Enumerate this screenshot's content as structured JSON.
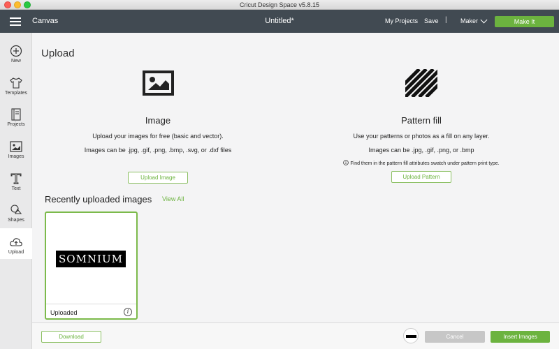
{
  "window": {
    "title": "Cricut Design Space  v5.8.15"
  },
  "header": {
    "canvas_label": "Canvas",
    "document_title": "Untitled*",
    "my_projects": "My Projects",
    "save": "Save",
    "separator": "|",
    "machine": "Maker",
    "make_it": "Make It"
  },
  "sidebar": {
    "items": [
      {
        "label": "New",
        "icon": "plus-circle-icon"
      },
      {
        "label": "Templates",
        "icon": "shirt-icon"
      },
      {
        "label": "Projects",
        "icon": "notebook-icon"
      },
      {
        "label": "Images",
        "icon": "image-icon"
      },
      {
        "label": "Text",
        "icon": "text-t-icon"
      },
      {
        "label": "Shapes",
        "icon": "shapes-icon"
      },
      {
        "label": "Upload",
        "icon": "cloud-upload-icon"
      }
    ],
    "active": "Upload"
  },
  "main": {
    "title": "Upload",
    "image_option": {
      "title": "Image",
      "description": "Upload your images for free (basic and vector).",
      "formats": "Images can be .jpg, .gif, .png, .bmp, .svg, or .dxf files",
      "button": "Upload Image"
    },
    "pattern_option": {
      "title": "Pattern fill",
      "description": "Use your patterns or photos as a fill on any layer.",
      "formats": "Images can be .jpg, .gif, .png, or .bmp",
      "note": "Find them in the pattern fill attributes swatch under pattern print type.",
      "button": "Upload Pattern"
    },
    "recent": {
      "title": "Recently uploaded images",
      "view_all": "View All",
      "items": [
        {
          "thumb_text": "SOMNIUM",
          "label": "Uploaded"
        }
      ]
    }
  },
  "footer": {
    "download": "Download",
    "cancel": "Cancel",
    "insert": "Insert Images"
  },
  "colors": {
    "accent": "#6cb33f",
    "header_bg": "#414a52",
    "disabled": "#c7c7c7"
  }
}
